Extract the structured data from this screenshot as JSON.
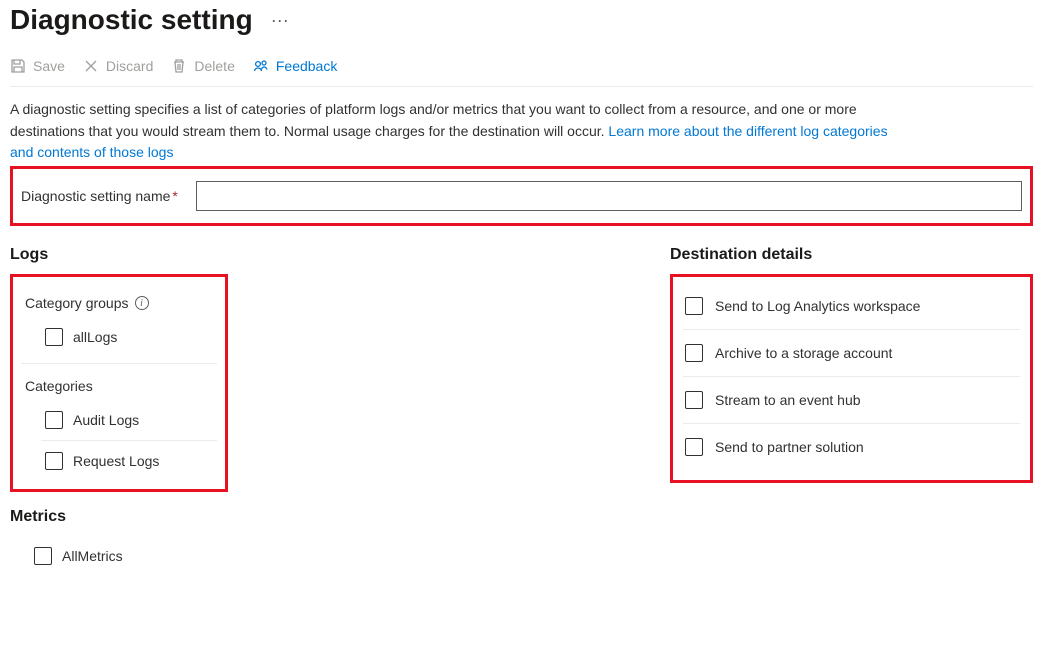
{
  "title": "Diagnostic setting",
  "toolbar": {
    "save": "Save",
    "discard": "Discard",
    "delete": "Delete",
    "feedback": "Feedback"
  },
  "intro": {
    "text1": "A diagnostic setting specifies a list of categories of platform logs and/or metrics that you want to collect from a resource, and one or more destinations that you would stream them to. Normal usage charges for the destination will occur. ",
    "link": "Learn more about the different log categories and contents of those logs"
  },
  "nameField": {
    "label": "Diagnostic setting name",
    "value": ""
  },
  "logs": {
    "heading": "Logs",
    "categoryGroupsLabel": "Category groups",
    "allLogs": "allLogs",
    "categoriesLabel": "Categories",
    "items": [
      {
        "label": "Audit Logs"
      },
      {
        "label": "Request Logs"
      }
    ]
  },
  "metrics": {
    "heading": "Metrics",
    "allMetrics": "AllMetrics"
  },
  "destinations": {
    "heading": "Destination details",
    "items": [
      {
        "label": "Send to Log Analytics workspace"
      },
      {
        "label": "Archive to a storage account"
      },
      {
        "label": "Stream to an event hub"
      },
      {
        "label": "Send to partner solution"
      }
    ]
  }
}
